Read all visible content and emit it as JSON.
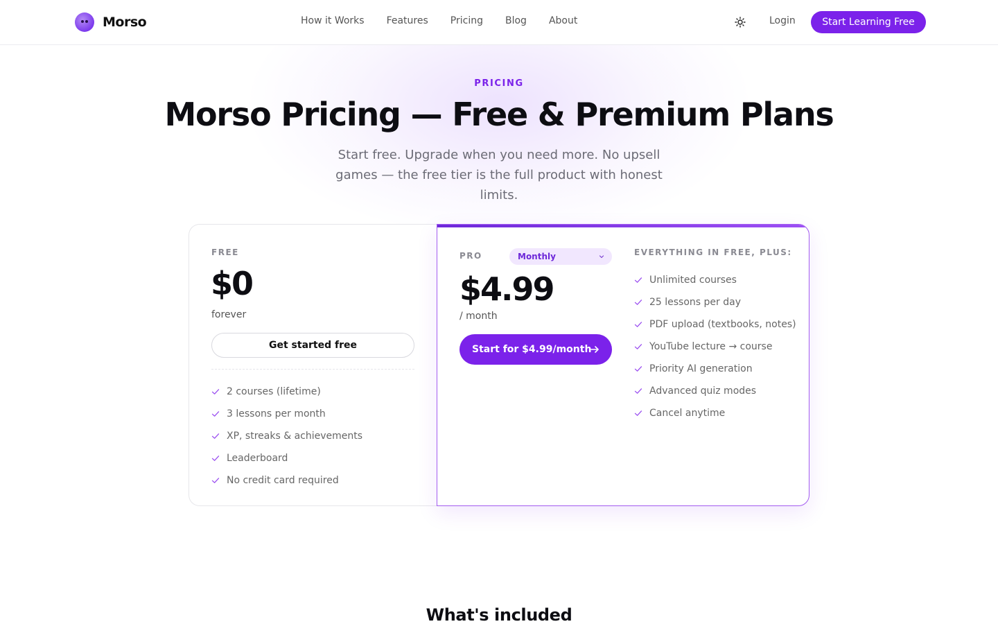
{
  "brand": {
    "name": "Morso"
  },
  "nav": {
    "items": [
      "How it Works",
      "Features",
      "Pricing",
      "Blog",
      "About"
    ]
  },
  "header": {
    "theme_icon": "sun-icon",
    "login_label": "Login",
    "cta_label": "Start Learning Free"
  },
  "hero": {
    "eyebrow": "PRICING",
    "title": "Morso Pricing — Free & Premium Plans",
    "subtitle": "Start free. Upgrade when you need more. No upsell games — the free tier is the full product with honest limits."
  },
  "plans": {
    "free": {
      "label": "FREE",
      "price": "$0",
      "period": "forever",
      "button_label": "Get started free",
      "features": [
        "2 courses (lifetime)",
        "3 lessons per month",
        "XP, streaks & achievements",
        "Leaderboard",
        "No credit card required"
      ]
    },
    "pro": {
      "label": "PRO",
      "billing_selected": "Monthly",
      "price": "$4.99",
      "period": "/ month",
      "button_label": "Start for $4.99/month",
      "includes_label": "EVERYTHING IN FREE, PLUS:",
      "features": [
        "Unlimited courses",
        "25 lessons per day",
        "PDF upload (textbooks, notes)",
        "YouTube lecture → course",
        "Priority AI generation",
        "Advanced quiz modes",
        "Cancel anytime"
      ]
    }
  },
  "next_section": {
    "title": "What's included"
  },
  "colors": {
    "accent": "#7b22ea",
    "accent_soft": "#f1e7fe",
    "text": "#0d0d12",
    "muted": "#6b6b75"
  }
}
